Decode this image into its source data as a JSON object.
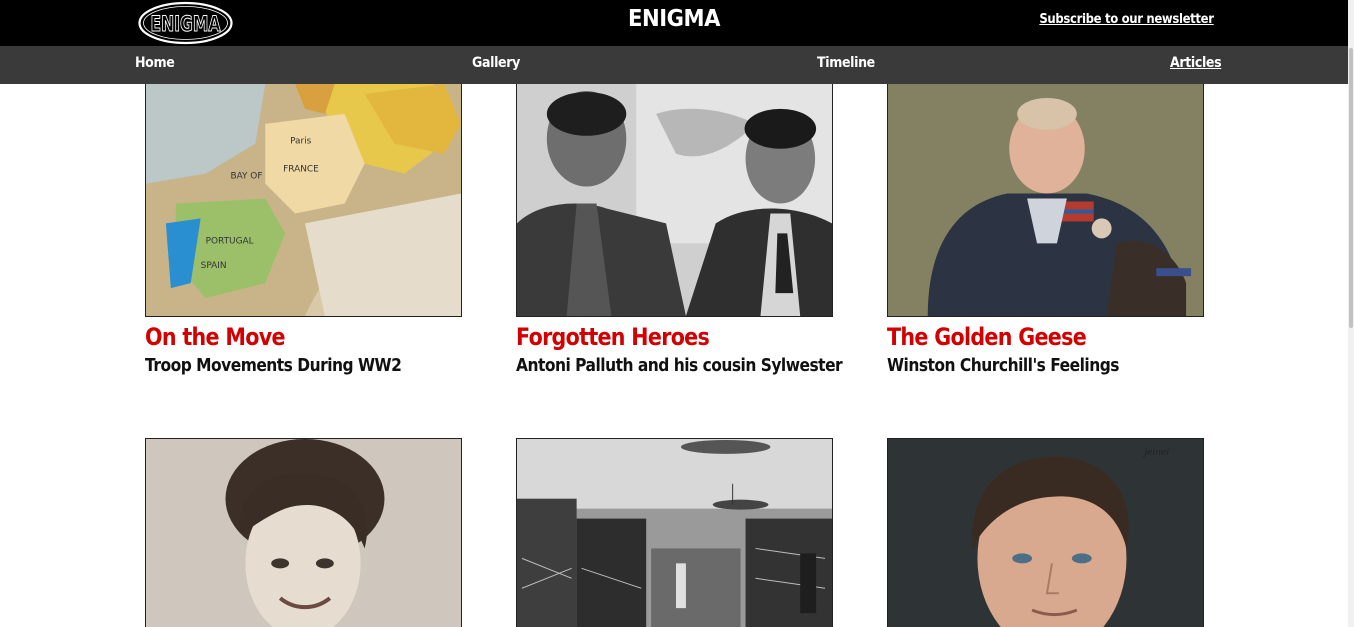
{
  "header": {
    "logo_text": "ENIGMA",
    "title": "ENIGMA",
    "subscribe_label": "Subscribe to our newsletter"
  },
  "nav": {
    "items": [
      {
        "label": "Home",
        "active": false
      },
      {
        "label": "Gallery",
        "active": false
      },
      {
        "label": "Timeline",
        "active": false
      },
      {
        "label": "Articles",
        "active": true
      }
    ]
  },
  "articles": [
    {
      "title": "On the Move",
      "subtitle": "Troop Movements During WW2",
      "image": "europe-map-globe"
    },
    {
      "title": "Forgotten Heroes",
      "subtitle": "Antoni Palluth and his cousin Sylwester",
      "image": "two-men-photo"
    },
    {
      "title": "The Golden Geese",
      "subtitle": "Winston Churchill's Feelings",
      "image": "churchill-portrait"
    },
    {
      "title": "",
      "subtitle": "",
      "image": "woman-portrait"
    },
    {
      "title": "",
      "subtitle": "",
      "image": "computer-room-photo"
    },
    {
      "title": "",
      "subtitle": "",
      "image": "turing-portrait"
    }
  ],
  "colors": {
    "topbar": "#000000",
    "navbar": "#3a3a3a",
    "accent": "#d40000"
  }
}
